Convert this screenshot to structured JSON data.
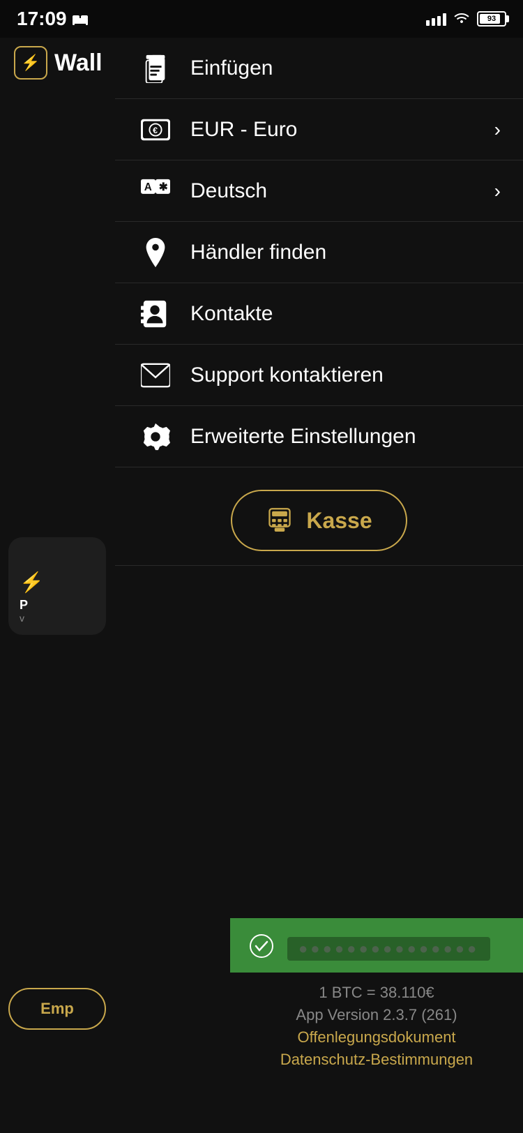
{
  "statusBar": {
    "time": "17:09",
    "battery": "93"
  },
  "app": {
    "name": "Wall",
    "logoIcon": "⚡"
  },
  "menu": {
    "items": [
      {
        "id": "einfuegen",
        "label": "Einfügen",
        "icon": "paste",
        "hasChevron": false
      },
      {
        "id": "eur-euro",
        "label": "EUR - Euro",
        "icon": "money",
        "hasChevron": true
      },
      {
        "id": "deutsch",
        "label": "Deutsch",
        "icon": "language",
        "hasChevron": true
      },
      {
        "id": "haendler-finden",
        "label": "Händler finden",
        "icon": "location",
        "hasChevron": false
      },
      {
        "id": "kontakte",
        "label": "Kontakte",
        "icon": "contacts",
        "hasChevron": false
      },
      {
        "id": "support-kontaktieren",
        "label": "Support kontaktieren",
        "icon": "email",
        "hasChevron": false
      },
      {
        "id": "erweiterte-einstellungen",
        "label": "Erweiterte Einstellungen",
        "icon": "settings",
        "hasChevron": false
      }
    ],
    "kasseButton": "Kasse"
  },
  "notification": {
    "text": "██████████████████"
  },
  "footer": {
    "btcRate": "1 BTC = 38.110€",
    "appVersion": "App Version 2.3.7 (261)",
    "offenlegungLink": "Offenlegungsdokument",
    "datenschutzLink": "Datenschutz-Bestimmungen"
  },
  "bottomNav": {
    "receiveLabel": "Emp"
  }
}
